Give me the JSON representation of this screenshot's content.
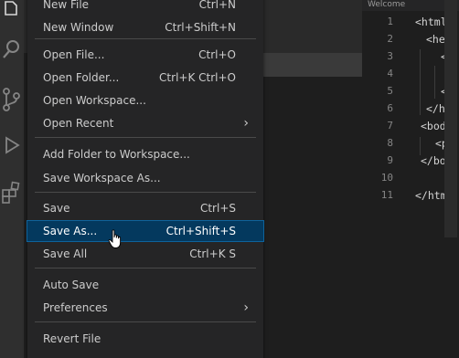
{
  "menu": {
    "items": [
      {
        "label": "New File",
        "shortcut": "Ctrl+N"
      },
      {
        "label": "New Window",
        "shortcut": "Ctrl+Shift+N"
      },
      {
        "label": "Open File...",
        "shortcut": "Ctrl+O"
      },
      {
        "label": "Open Folder...",
        "shortcut": "Ctrl+K Ctrl+O"
      },
      {
        "label": "Open Workspace...",
        "shortcut": ""
      },
      {
        "label": "Open Recent",
        "shortcut": ""
      },
      {
        "label": "Add Folder to Workspace...",
        "shortcut": ""
      },
      {
        "label": "Save Workspace As...",
        "shortcut": ""
      },
      {
        "label": "Save",
        "shortcut": "Ctrl+S"
      },
      {
        "label": "Save As...",
        "shortcut": "Ctrl+Shift+S"
      },
      {
        "label": "Save All",
        "shortcut": "Ctrl+K S"
      },
      {
        "label": "Auto Save",
        "shortcut": ""
      },
      {
        "label": "Preferences",
        "shortcut": ""
      },
      {
        "label": "Revert File",
        "shortcut": ""
      }
    ],
    "highlighted_label": "Save As..."
  },
  "editor": {
    "tab_label": "Welcome",
    "lines": [
      {
        "n": "1",
        "code": "<html>"
      },
      {
        "n": "2",
        "code": "<hea"
      },
      {
        "n": "3",
        "code": "<t"
      },
      {
        "n": "4",
        "code": ""
      },
      {
        "n": "5",
        "code": "</"
      },
      {
        "n": "6",
        "code": "</he"
      },
      {
        "n": "7",
        "code": "<body"
      },
      {
        "n": "8",
        "code": "<p>"
      },
      {
        "n": "9",
        "code": "</bod"
      },
      {
        "n": "10",
        "code": ""
      },
      {
        "n": "11",
        "code": "</html"
      }
    ]
  },
  "activity_bar": {
    "icons": [
      "explorer-icon",
      "search-icon",
      "source-control-icon",
      "run-debug-icon",
      "extensions-icon"
    ]
  },
  "colors": {
    "menu_bg": "#252526",
    "highlight_bg": "#04395e",
    "text": "#cccccc",
    "line_number": "#858585"
  }
}
